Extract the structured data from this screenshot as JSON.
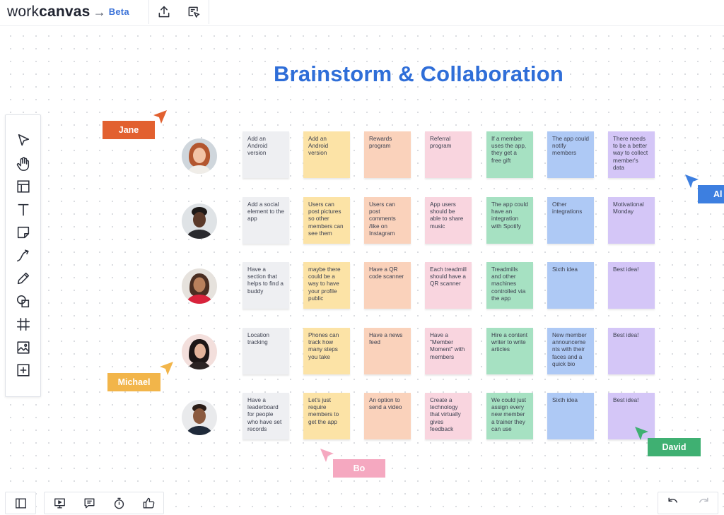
{
  "app": {
    "brand_light": "work",
    "brand_bold": "canvas",
    "arrow": "→",
    "beta": "Beta"
  },
  "top_actions": [
    {
      "name": "upload-icon",
      "label": "Upload"
    },
    {
      "name": "present-cursor-icon",
      "label": "Select area"
    }
  ],
  "board_title": "Brainstorm & Collaboration",
  "tools": [
    "select-pointer-icon",
    "hand-pan-icon",
    "template-layout-icon",
    "text-tool-icon",
    "sticky-note-icon",
    "connector-arrow-icon",
    "pen-icon",
    "shapes-icon",
    "frame-grid-icon",
    "image-icon",
    "add-more-icon"
  ],
  "notes": [
    [
      "Add an Android version",
      "Add an Android version",
      "Rewards program",
      "Referral program",
      "If a member uses the app, they get a free gift",
      "The app could notify members",
      "There needs to be a better way to collect member's data"
    ],
    [
      "Add a social element to the app",
      "Users can post pictures so other members can see them",
      "Users can post comments /like on Instagram",
      "App users should be able to share music",
      "The app could have an integration with Spotify",
      "Other integrations",
      "Motivational Monday"
    ],
    [
      "Have a section that helps to find a buddy",
      "maybe there could be a way to have your profile public",
      "Have a QR code scanner",
      "Each treadmill should have a QR scanner",
      "Treadmills and other machines controlled via the app",
      "Sixth idea",
      "Best idea!"
    ],
    [
      "Location tracking",
      "Phones can track how many steps you take",
      "Have a news feed",
      "Have a \"Member Moment\" with members",
      "Hire a content writer to write articles",
      "New member announceme nts with their faces and a quick bio",
      "Best idea!"
    ],
    [
      "Have a leaderboard for people who have set records",
      "Let's just require members to get the app",
      "An option to send a video",
      "Create a technology that virtually gives feedback",
      "We could just assign every new member a trainer they can use",
      "Sixth idea",
      "Best idea!"
    ]
  ],
  "note_colors": [
    "gray",
    "yellow",
    "peach",
    "pink",
    "green",
    "blue",
    "purple"
  ],
  "collaborators": {
    "jane": {
      "name": "Jane",
      "color": "#e2602f"
    },
    "al": {
      "name": "Al",
      "color": "#3d7fe0"
    },
    "michael": {
      "name": "Michael",
      "color": "#f2b54a"
    },
    "bo": {
      "name": "Bo",
      "color": "#f5a8c0"
    },
    "david": {
      "name": "David",
      "color": "#3fb072"
    }
  },
  "bottom_left_tools": [
    "sidebar-panel-icon",
    "present-screen-icon",
    "comment-icon",
    "timer-icon",
    "thumbs-up-icon"
  ],
  "bottom_right_tools": [
    "undo-icon",
    "redo-icon"
  ]
}
